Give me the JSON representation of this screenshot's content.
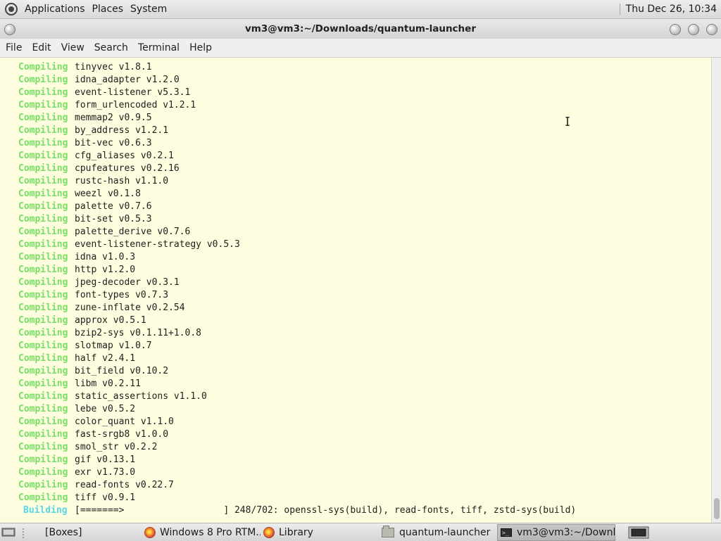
{
  "top_panel": {
    "menus": [
      "Applications",
      "Places",
      "System"
    ],
    "clock": "Thu Dec 26, 10:34"
  },
  "window": {
    "title": "vm3@vm3:~/Downloads/quantum-launcher",
    "menu": [
      "File",
      "Edit",
      "View",
      "Search",
      "Terminal",
      "Help"
    ]
  },
  "terminal": {
    "compiling_label": "Compiling",
    "building_label": "Building",
    "lines": [
      "tinyvec v1.8.1",
      "idna_adapter v1.2.0",
      "event-listener v5.3.1",
      "form_urlencoded v1.2.1",
      "memmap2 v0.9.5",
      "by_address v1.2.1",
      "bit-vec v0.6.3",
      "cfg_aliases v0.2.1",
      "cpufeatures v0.2.16",
      "rustc-hash v1.1.0",
      "weezl v0.1.8",
      "palette v0.7.6",
      "bit-set v0.5.3",
      "palette_derive v0.7.6",
      "event-listener-strategy v0.5.3",
      "idna v1.0.3",
      "http v1.2.0",
      "jpeg-decoder v0.3.1",
      "font-types v0.7.3",
      "zune-inflate v0.2.54",
      "approx v0.5.1",
      "bzip2-sys v0.1.11+1.0.8",
      "slotmap v1.0.7",
      "half v2.4.1",
      "bit_field v0.10.2",
      "libm v0.2.11",
      "static_assertions v1.1.0",
      "lebe v0.5.2",
      "color_quant v1.1.0",
      "fast-srgb8 v1.0.0",
      "smol_str v0.2.2",
      "gif v0.13.1",
      "exr v1.73.0",
      "read-fonts v0.22.7",
      "tiff v0.9.1"
    ],
    "build_status": "[=======>                  ] 248/702: openssl-sys(build), read-fonts, tiff, zstd-sys(build)",
    "build_progress": 0.3533,
    "cursor_icon": "i-beam-cursor"
  },
  "taskbar": {
    "items": [
      {
        "label": "[Boxes]",
        "icon": ""
      },
      {
        "label": "Windows 8 Pro RTM...",
        "icon": "firefox-icon"
      },
      {
        "label": "Library",
        "icon": "firefox-icon"
      },
      {
        "label": "quantum-launcher",
        "icon": "folder-icon"
      },
      {
        "label": "vm3@vm3:~/Downl...",
        "icon": "terminal-icon"
      }
    ],
    "show_desktop_icon": "show-desktop-icon",
    "workspace_icon": "workspace-switcher-icon"
  },
  "colors": {
    "terminal_bg": "#fffde0",
    "compiling": "#77e064",
    "building": "#56d8e6",
    "panel": "#e5e5e5"
  }
}
